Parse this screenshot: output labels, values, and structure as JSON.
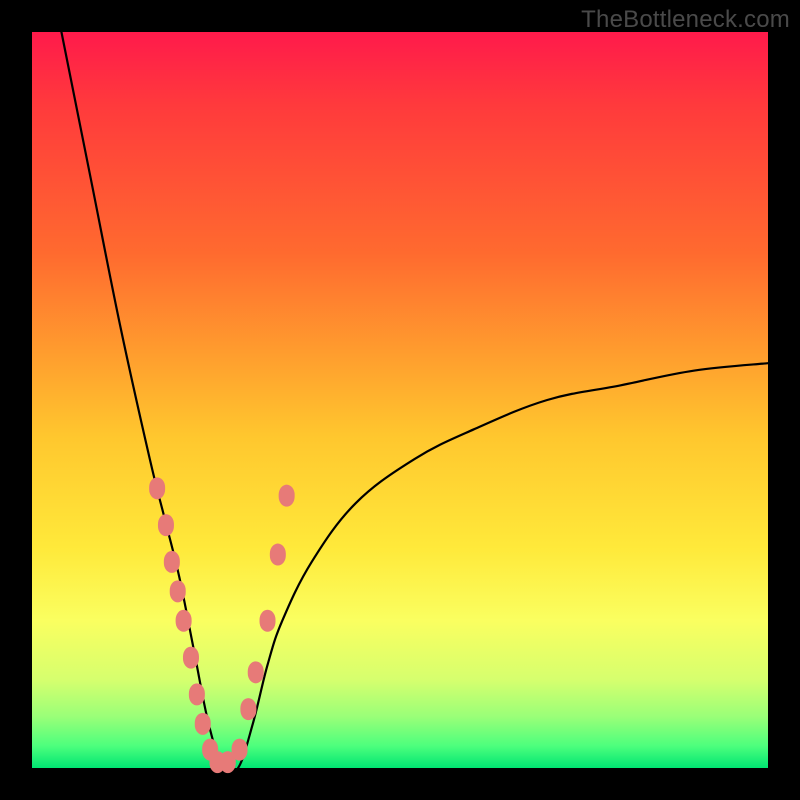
{
  "watermark": "TheBottleneck.com",
  "colors": {
    "dot": "#e77a78",
    "curve": "#000000",
    "frame": "#000000"
  },
  "chart_data": {
    "type": "line",
    "title": "",
    "xlabel": "",
    "ylabel": "",
    "xlim": [
      0,
      100
    ],
    "ylim": [
      0,
      100
    ],
    "annotations": [
      "TheBottleneck.com"
    ],
    "grid": false,
    "legend": false,
    "series_note": "V-shaped bottleneck curve; y≈0 at minimum near x≈24–28, rising to ~100 at x≈4 and ~55 at x≈100. Salmon scatter dots cluster on both flanks in the 0–40 y-range.",
    "series": [
      {
        "name": "curve",
        "type": "line",
        "x": [
          4,
          8,
          12,
          16,
          18,
          20,
          22,
          24,
          26,
          28,
          30,
          32,
          34,
          38,
          44,
          52,
          60,
          70,
          80,
          90,
          100
        ],
        "y": [
          100,
          80,
          60,
          42,
          34,
          26,
          16,
          6,
          0,
          0,
          6,
          14,
          20,
          28,
          36,
          42,
          46,
          50,
          52,
          54,
          55
        ]
      },
      {
        "name": "dots",
        "type": "scatter",
        "x": [
          17.0,
          18.2,
          19.0,
          19.8,
          20.6,
          21.6,
          22.4,
          23.2,
          24.2,
          25.2,
          26.6,
          28.2,
          29.4,
          30.4,
          32.0,
          33.4,
          34.6
        ],
        "y": [
          38.0,
          33.0,
          28.0,
          24.0,
          20.0,
          15.0,
          10.0,
          6.0,
          2.5,
          0.8,
          0.8,
          2.5,
          8.0,
          13.0,
          20.0,
          29.0,
          37.0
        ]
      }
    ]
  }
}
